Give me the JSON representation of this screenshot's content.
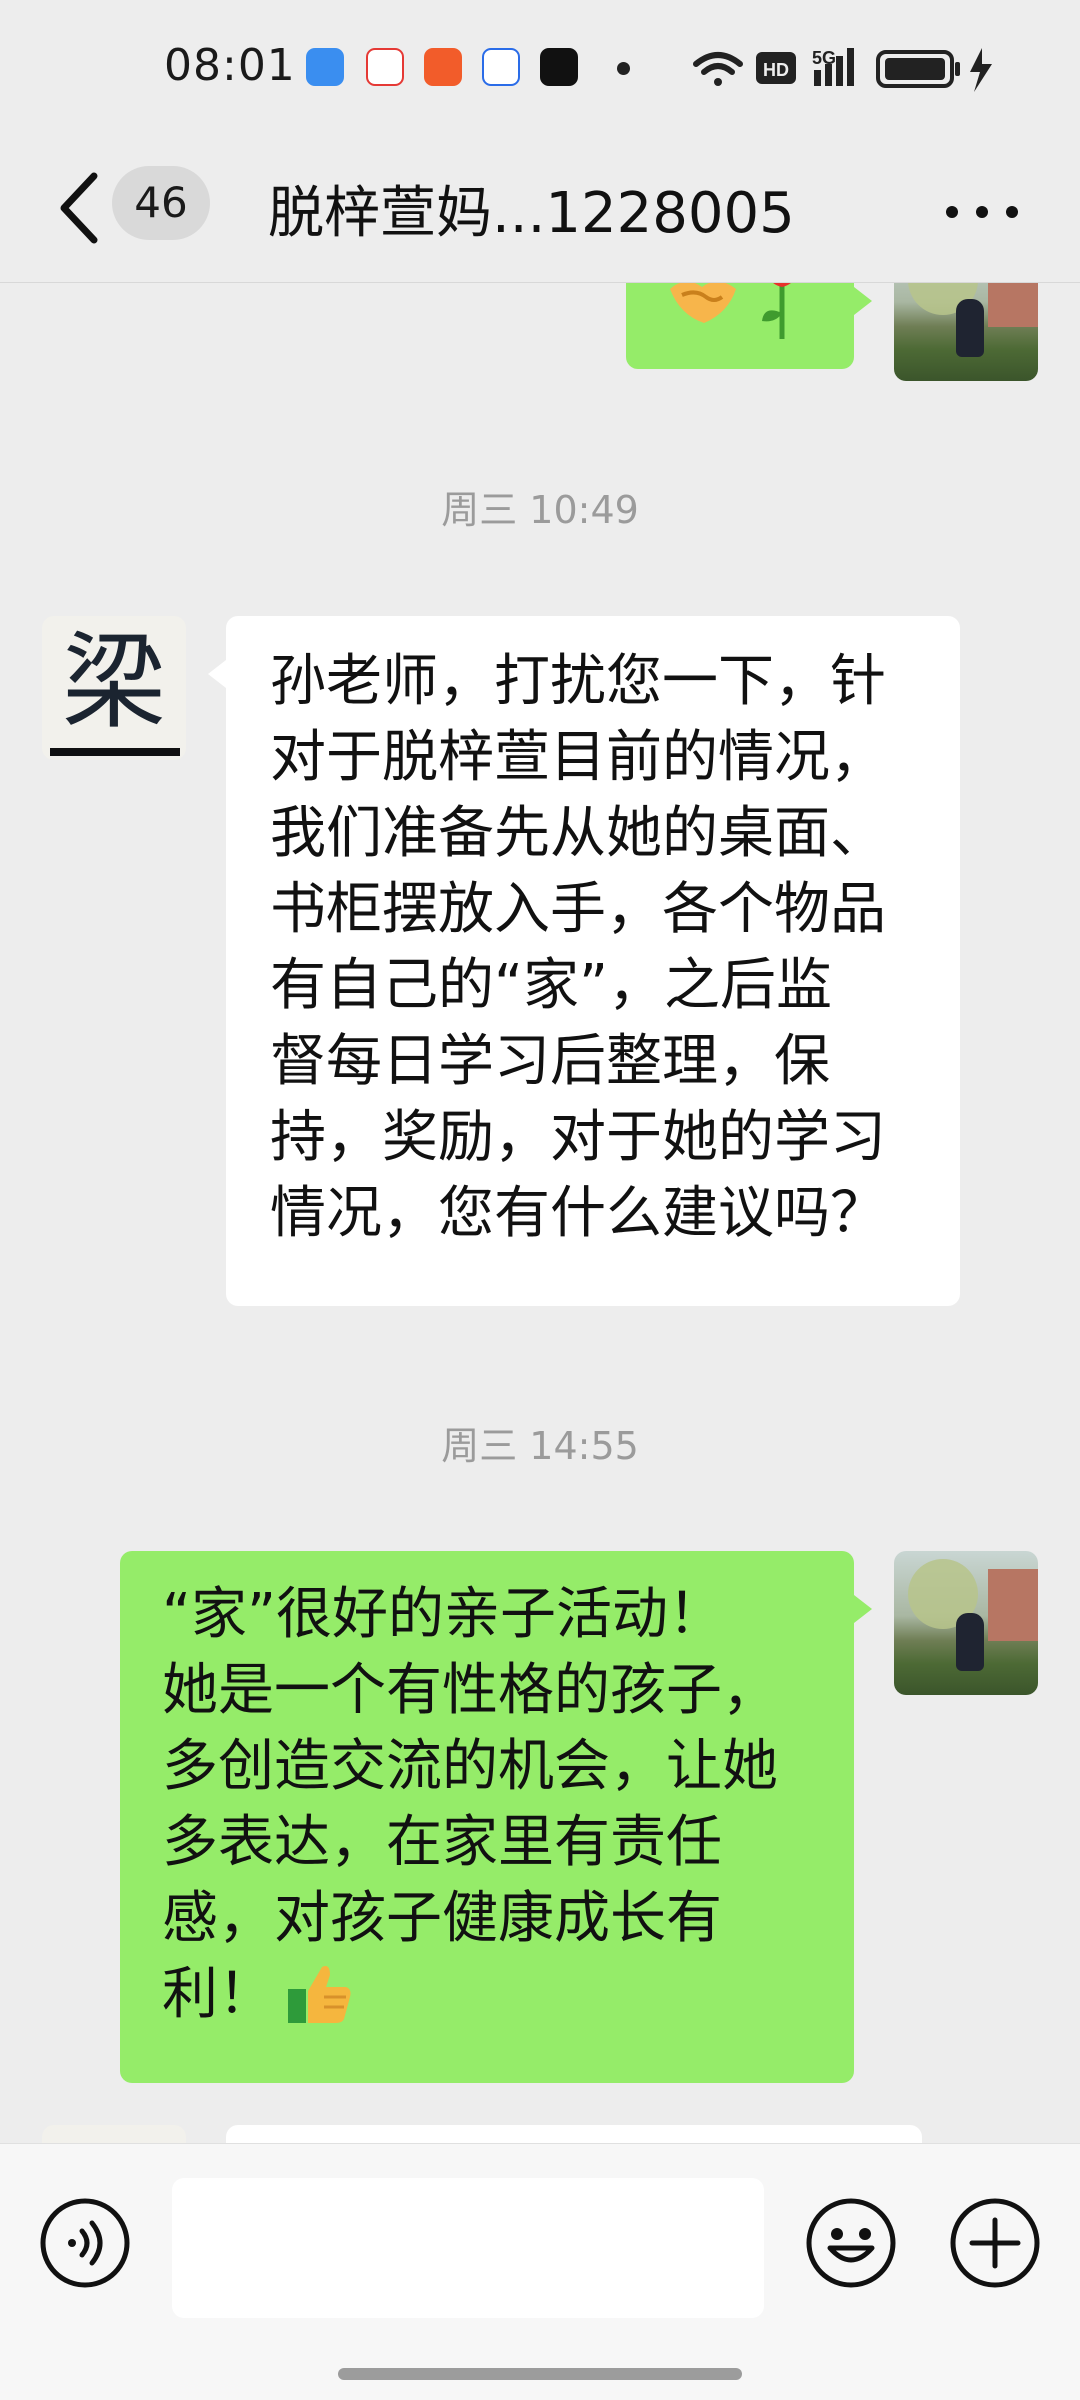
{
  "status_bar": {
    "time": "08:01",
    "network_label": "HD",
    "network_type": "5G"
  },
  "header": {
    "unread_count": "46",
    "title": "脱梓萱妈...1228005"
  },
  "avatars": {
    "other_glyph": "梁"
  },
  "messages": [
    {
      "sender": "self",
      "emojis": [
        "handshake",
        "rose"
      ]
    },
    {
      "type": "timestamp",
      "text": "周三 10:49"
    },
    {
      "sender": "other",
      "lines": [
        "孙老师，打扰您一下，针",
        "对于脱梓萱目前的情况，",
        "我们准备先从她的桌面、",
        "书柜摆放入手，各个物品",
        "有自己的“家”，之后监",
        "督每日学习后整理，保",
        "持，奖励，对于她的学习",
        "情况，您有什么建议吗？"
      ]
    },
    {
      "type": "timestamp",
      "text": "周三 14:55"
    },
    {
      "sender": "self",
      "lines": [
        "“家”很好的亲子活动！",
        "她是一个有性格的孩子，",
        "多创造交流的机会，让她",
        "多表达，在家里有责任",
        "感，对孩子健康成长有",
        "利！"
      ],
      "emojis": [
        "thumbs-up"
      ]
    }
  ],
  "colors": {
    "background": "#ededed",
    "bubble_self": "#95ec69",
    "bubble_other": "#ffffff",
    "timestamp_text": "#9b9b9b"
  }
}
